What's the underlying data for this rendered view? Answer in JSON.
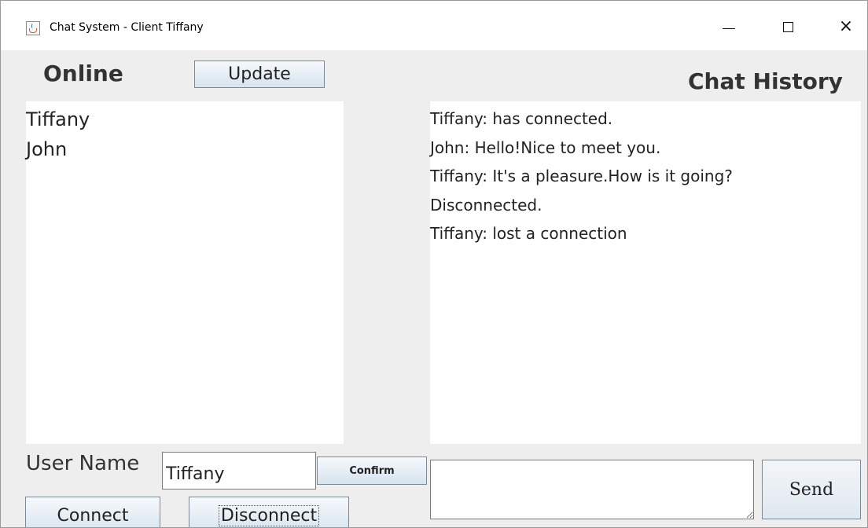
{
  "window": {
    "title": "Chat System - Client Tiffany",
    "icon": "java-cup-icon",
    "controls": {
      "minimize": "minimize-icon",
      "maximize": "maximize-icon",
      "close": "×"
    }
  },
  "online": {
    "label": "Online",
    "update_button": "Update",
    "users": [
      "Tiffany",
      "John"
    ]
  },
  "chat": {
    "label": "Chat History",
    "messages": [
      "Tiffany: has connected.",
      "John: Hello!Nice to meet you.",
      "Tiffany: It's a pleasure.How is it going?",
      "Disconnected.",
      "Tiffany: lost a connection"
    ],
    "input_value": "",
    "send_button": "Send"
  },
  "user": {
    "label": "User Name",
    "value": "Tiffany",
    "confirm_button": "Confirm",
    "connect_button": "Connect",
    "disconnect_button": "Disconnect"
  },
  "colors": {
    "window_bg": "#eeeeee",
    "button_top": "#f6f9fc",
    "button_bottom": "#d7e3ee",
    "text": "#222222"
  }
}
